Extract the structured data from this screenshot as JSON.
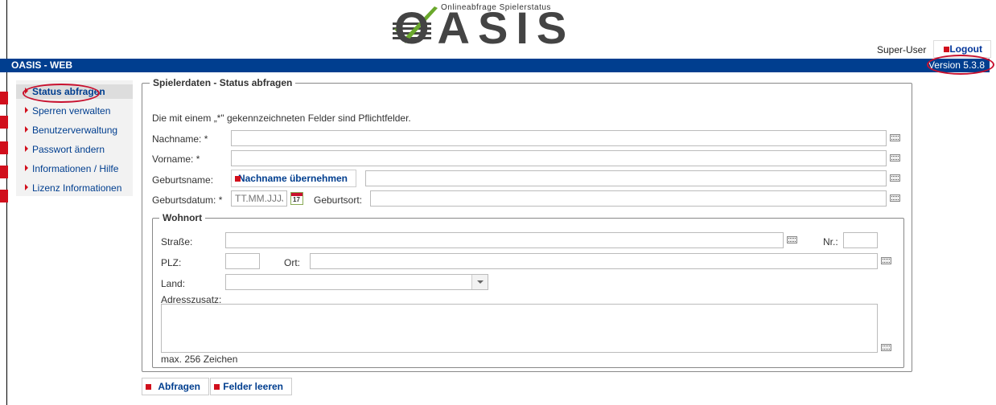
{
  "header": {
    "logo_text": "OASIS",
    "logo_tagline": "Onlineabfrage Spielerstatus",
    "user": "Super-User",
    "logout_label": "Logout"
  },
  "topbar": {
    "title": "OASIS - WEB",
    "version": "Version 5.3.8"
  },
  "sidebar": {
    "items": [
      {
        "label": "Status abfragen",
        "active": true
      },
      {
        "label": "Sperren verwalten"
      },
      {
        "label": "Benutzerverwaltung"
      },
      {
        "label": "Passwort ändern"
      },
      {
        "label": "Informationen / Hilfe"
      },
      {
        "label": "Lizenz Informationen"
      }
    ]
  },
  "form": {
    "legend": "Spielerdaten - Status abfragen",
    "required_note": "Die mit einem „*\" gekennzeichneten Felder sind Pflichtfelder.",
    "nachname_label": "Nachname: *",
    "vorname_label": "Vorname: *",
    "geburtsname_label": "Geburtsname:",
    "copy_button": "Nachname übernehmen",
    "geburtsdatum_label": "Geburtsdatum: *",
    "geburtsdatum_placeholder": "TT.MM.JJJJ",
    "calendar_day": "17",
    "geburtsort_label": "Geburtsort:",
    "wohnort": {
      "legend": "Wohnort",
      "strasse_label": "Straße:",
      "nr_label": "Nr.:",
      "plz_label": "PLZ:",
      "ort_label": "Ort:",
      "land_label": "Land:",
      "adresszusatz_label": "Adresszusatz:",
      "max_note": "max. 256 Zeichen"
    }
  },
  "actions": {
    "submit": "Abfragen",
    "clear": "Felder leeren"
  },
  "colors": {
    "brand_blue": "#003e8f",
    "accent_red": "#d10f1c"
  }
}
